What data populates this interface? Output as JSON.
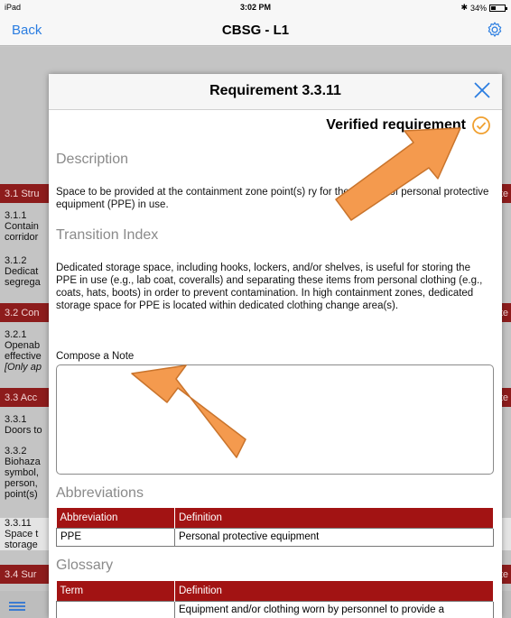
{
  "status": {
    "carrier": "iPad",
    "time": "3:02 PM",
    "battery": "34%"
  },
  "nav": {
    "back_label": "Back",
    "title": "CBSG - L1",
    "settings_icon": "gear-icon"
  },
  "background_list": {
    "rows": [
      {
        "kind": "section",
        "text": "3.1 Stru",
        "note": "ote"
      },
      {
        "kind": "item",
        "lines": [
          "3.1.1",
          "Contain",
          "corridor"
        ]
      },
      {
        "kind": "item",
        "lines": [
          "3.1.2",
          "Dedicat",
          "segrega"
        ]
      },
      {
        "kind": "section",
        "text": "3.2 Con",
        "note": "ote"
      },
      {
        "kind": "item",
        "lines": [
          "3.2.1",
          "Openab",
          "effective",
          "[Only ap"
        ]
      },
      {
        "kind": "section",
        "text": "3.3 Acc",
        "note": "ote"
      },
      {
        "kind": "item",
        "lines": [
          "3.3.1",
          "Doors to"
        ]
      },
      {
        "kind": "item",
        "lines": [
          "3.3.2",
          "Biohaza",
          "symbol,",
          "person,",
          "point(s)"
        ]
      },
      {
        "kind": "item",
        "lines": [
          "3.3.11",
          "Space t",
          "storage"
        ]
      },
      {
        "kind": "section",
        "text": "3.4 Sur",
        "note": "ote"
      }
    ]
  },
  "modal": {
    "title": "Requirement 3.3.11",
    "verified_label": "Verified requirement",
    "description_heading": "Description",
    "description_text": "Space to be provided at the containment zone point(s) ry for the storage of personal protective equipment (PPE) in use.",
    "transition_heading": "Transition Index",
    "transition_text": "Dedicated storage space, including hooks, lockers, and/or shelves, is useful for storing the PPE in use (e.g., lab coat, coveralls) and separating these items from personal clothing (e.g., coats, hats, boots) in order to prevent contamination. In high containment zones, dedicated storage space for PPE is located within dedicated clothing change area(s).",
    "note_label": "Compose a Note",
    "note_value": "",
    "abbreviations_heading": "Abbreviations",
    "abbreviations": {
      "headers": [
        "Abbreviation",
        "Definition"
      ],
      "rows": [
        [
          "PPE",
          "Personal protective equipment"
        ]
      ]
    },
    "glossary_heading": "Glossary",
    "glossary": {
      "headers": [
        "Term",
        "Definition"
      ],
      "rows": [
        [
          "",
          "Equipment and/or clothing worn by personnel to provide a"
        ]
      ]
    }
  },
  "colors": {
    "accent_blue": "#2a7de1",
    "header_red": "#a21313",
    "section_red": "#8d1c1c",
    "verified_orange": "#f0a030",
    "annotation_arrow": "#f49a4e"
  }
}
